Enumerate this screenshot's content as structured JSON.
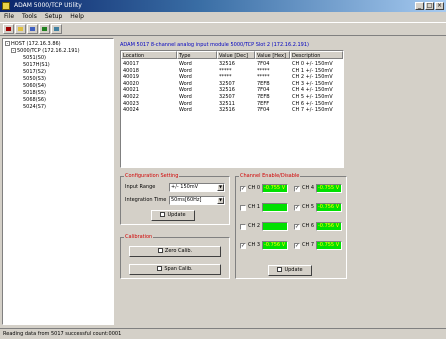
{
  "window": {
    "title": "ADAM 5000/TCP Utility"
  },
  "menu": [
    "File",
    "Tools",
    "Setup",
    "Help"
  ],
  "tree": {
    "host": "HOST (172.16.3.86)",
    "device": "5000/TCP (172.16.2.191)",
    "slots": [
      "5051(S0)",
      "5017H(S1)",
      "5017(S2)",
      "5050(S3)",
      "5060(S4)",
      "5018(S5)",
      "5068(S6)",
      "5024(S7)"
    ]
  },
  "module": {
    "title": "ADAM 5017 8-channel analog input module     5000/TCP Slot 2 (172.16.2.191)"
  },
  "table": {
    "columns": [
      "Location",
      "Type",
      "Value [Dec]",
      "Value [Hex]",
      "Description"
    ],
    "rows": [
      [
        "40017",
        "Word",
        "32516",
        "7F04",
        "CH 0  +/- 150mV"
      ],
      [
        "40018",
        "Word",
        "*****",
        "*****",
        "CH 1  +/- 150mV"
      ],
      [
        "40019",
        "Word",
        "*****",
        "*****",
        "CH 2  +/- 150mV"
      ],
      [
        "40020",
        "Word",
        "32507",
        "7EFB",
        "CH 3  +/- 150mV"
      ],
      [
        "40021",
        "Word",
        "32516",
        "7F04",
        "CH 4  +/- 150mV"
      ],
      [
        "40022",
        "Word",
        "32507",
        "7EFB",
        "CH 5  +/- 150mV"
      ],
      [
        "40023",
        "Word",
        "32511",
        "7EFF",
        "CH 6  +/- 150mV"
      ],
      [
        "40024",
        "Word",
        "32516",
        "7F04",
        "CH 7  +/- 150mV"
      ]
    ]
  },
  "config": {
    "title": "Configuration Setting",
    "input_range_label": "Input Range",
    "input_range_value": "+/- 150mV",
    "integration_label": "Integration Time",
    "integration_value": "50ms[60Hz]",
    "update_label": "Update"
  },
  "calibration": {
    "title": "Calibration",
    "zero_label": "Zero Calib.",
    "span_label": "Span Calib."
  },
  "channels": {
    "title": "Channel Enable/Disable",
    "update_label": "Update",
    "items": [
      {
        "label": "CH 0",
        "checked": true,
        "value": "-0.755 V"
      },
      {
        "label": "CH 1",
        "checked": false,
        "value": ""
      },
      {
        "label": "CH 2",
        "checked": false,
        "value": ""
      },
      {
        "label": "CH 3",
        "checked": true,
        "value": "-0.756 V"
      },
      {
        "label": "CH 4",
        "checked": true,
        "value": "-0.755 V"
      },
      {
        "label": "CH 5",
        "checked": true,
        "value": "-0.756 V"
      },
      {
        "label": "CH 6",
        "checked": true,
        "value": "-0.756 V"
      },
      {
        "label": "CH 7",
        "checked": true,
        "value": "-0.755 V"
      }
    ]
  },
  "status": {
    "text": "Reading data from 5017 successful   count:0001"
  },
  "colors": {
    "value_bg": "#00e000",
    "value_text": "#ffff00",
    "group_title": "#d00000",
    "module_title": "#0000c0"
  }
}
